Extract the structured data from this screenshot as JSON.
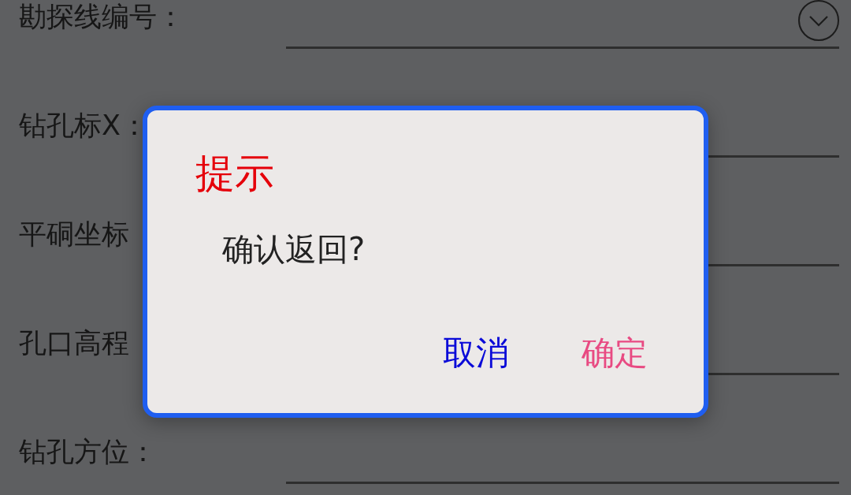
{
  "form": {
    "rows": [
      {
        "label": "勘探线编号：",
        "kind": "select"
      },
      {
        "label": "钻孔标X：",
        "kind": "text"
      },
      {
        "label": "平硐坐标",
        "kind": "text"
      },
      {
        "label": "孔口高程",
        "kind": "text"
      },
      {
        "label": "钻孔方位：",
        "kind": "text"
      }
    ]
  },
  "dialog": {
    "title": "提示",
    "message": "确认返回?",
    "buttons": [
      {
        "label": "取消",
        "kind": "cancel"
      },
      {
        "label": "确定",
        "kind": "confirm"
      }
    ]
  }
}
